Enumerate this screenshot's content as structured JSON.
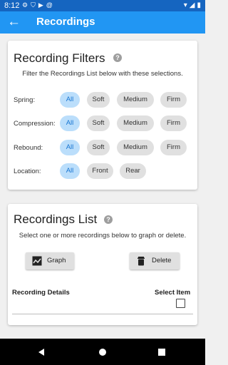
{
  "status_bar": {
    "time": "8:12",
    "status_icons": [
      "settings-icon",
      "shield-icon",
      "play-protect-icon",
      "at-sign-icon"
    ],
    "right_icons": [
      "wifi-icon",
      "signal-icon",
      "battery-icon"
    ]
  },
  "app_bar": {
    "back_icon": "arrow-left-icon",
    "title": "Recordings"
  },
  "filters": {
    "title": "Recording Filters",
    "help_icon": "?",
    "subtitle": "Filter the Recordings List below with these selections.",
    "rows": [
      {
        "label": "Spring:",
        "chips": [
          "All",
          "Soft",
          "Medium",
          "Firm"
        ],
        "selected": "All"
      },
      {
        "label": "Compression:",
        "chips": [
          "All",
          "Soft",
          "Medium",
          "Firm"
        ],
        "selected": "All"
      },
      {
        "label": "Rebound:",
        "chips": [
          "All",
          "Soft",
          "Medium",
          "Firm"
        ],
        "selected": "All"
      },
      {
        "label": "Location:",
        "chips": [
          "All",
          "Front",
          "Rear"
        ],
        "selected": "All"
      }
    ]
  },
  "recordings": {
    "title": "Recordings List",
    "help_icon": "?",
    "subtitle": "Select one or more recordings below to graph or delete.",
    "graph_button": "Graph",
    "delete_button": "Delete",
    "col_details": "Recording Details",
    "col_select": "Select Item"
  },
  "colors": {
    "primary": "#2196f3",
    "status_bar": "#1565c0",
    "chip_selected_bg": "#bbdefb",
    "chip_selected_text": "#1976d2",
    "chip_bg": "#e0e0e0"
  }
}
